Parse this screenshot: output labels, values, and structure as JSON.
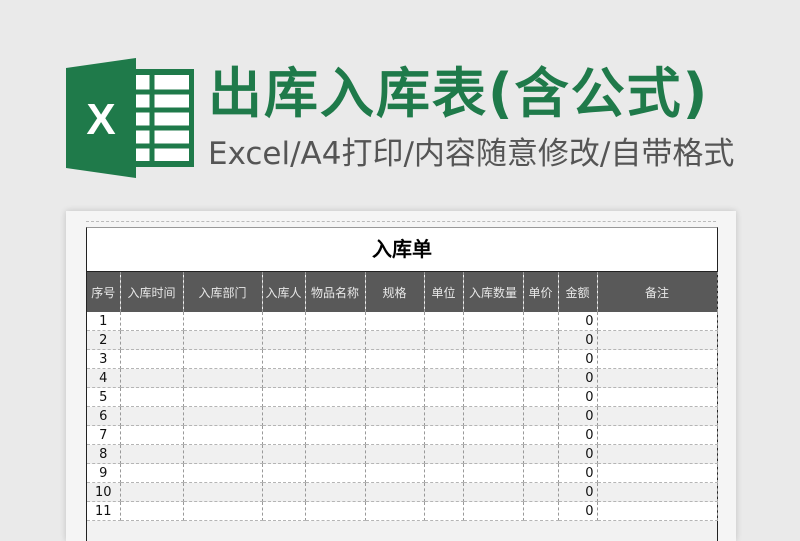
{
  "banner": {
    "title": "出库入库表(含公式)",
    "subtitle": "Excel/A4打印/内容随意修改/自带格式",
    "logo_letter": "X",
    "brand_color": "#1f7a4a"
  },
  "sheet": {
    "title": "入库单",
    "columns": [
      "序号",
      "入库时间",
      "入库部门",
      "入库人",
      "物品名称",
      "规格",
      "单位",
      "入库数量",
      "单价",
      "金额",
      "备注"
    ],
    "rows": [
      {
        "no": "1",
        "amount": "0"
      },
      {
        "no": "2",
        "amount": "0"
      },
      {
        "no": "3",
        "amount": "0"
      },
      {
        "no": "4",
        "amount": "0"
      },
      {
        "no": "5",
        "amount": "0"
      },
      {
        "no": "6",
        "amount": "0"
      },
      {
        "no": "7",
        "amount": "0"
      },
      {
        "no": "8",
        "amount": "0"
      },
      {
        "no": "9",
        "amount": "0"
      },
      {
        "no": "10",
        "amount": "0"
      },
      {
        "no": "11",
        "amount": "0"
      }
    ]
  }
}
